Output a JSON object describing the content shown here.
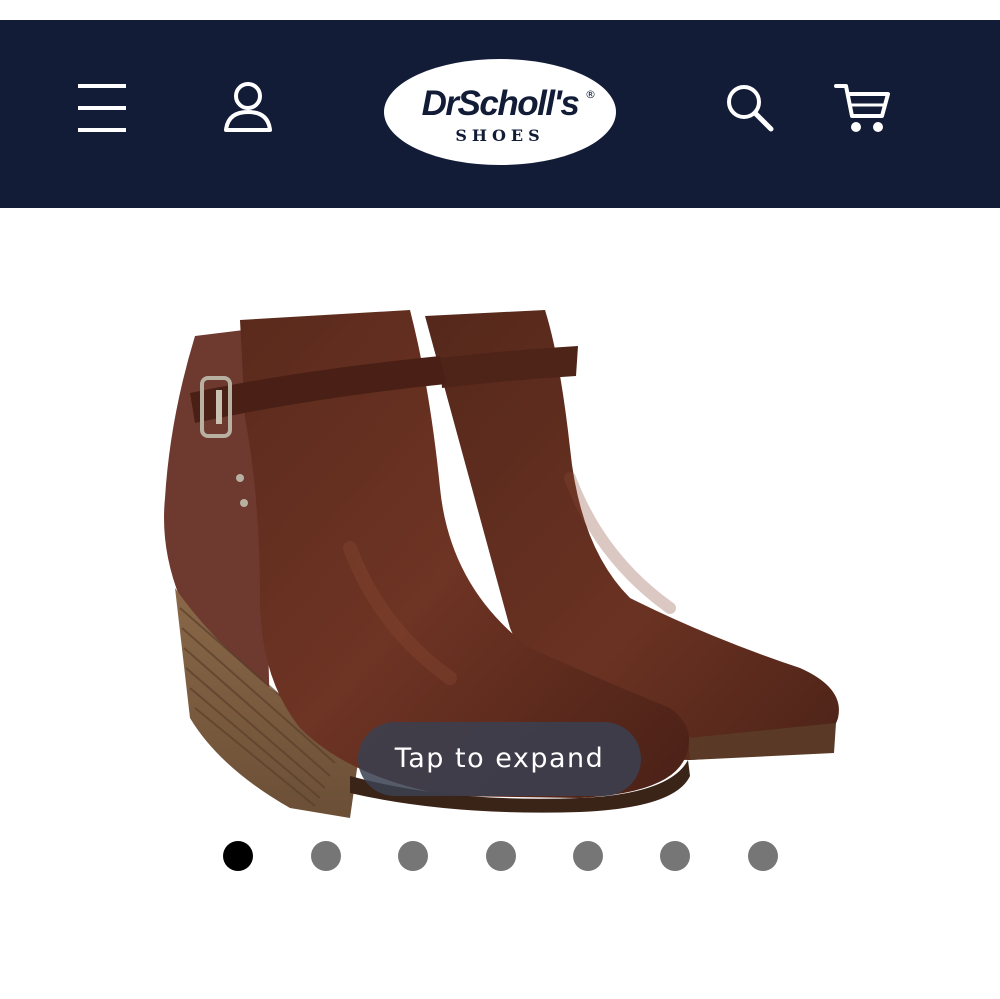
{
  "header": {
    "logo_brand": "DrScholl's",
    "logo_registered": "®",
    "logo_sub": "SHOES",
    "icons": {
      "menu": "hamburger-menu-icon",
      "account": "user-account-icon",
      "search": "search-icon",
      "cart": "shopping-cart-icon"
    }
  },
  "colors": {
    "header_bg": "#121c37",
    "icon": "#ffffff",
    "dot_active": "#000000",
    "dot_inactive": "#767676",
    "pill_bg": "#3a4050"
  },
  "gallery": {
    "expand_label": "Tap to expand",
    "image_subject": "brown leather wedge ankle boots with buckle strap",
    "total_images": 7,
    "active_index": 0
  }
}
